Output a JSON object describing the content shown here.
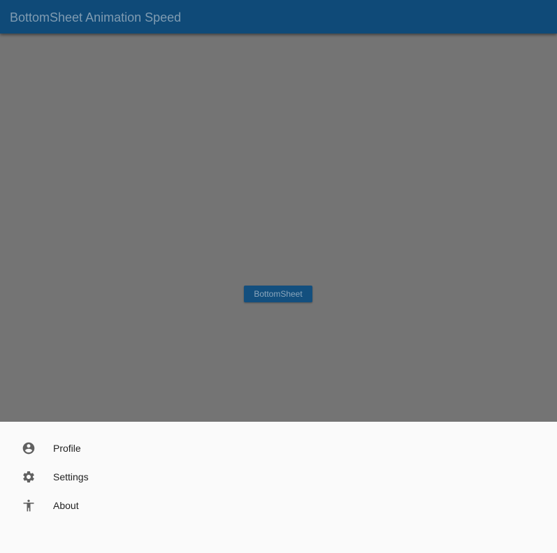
{
  "appbar": {
    "title": "BottomSheet Animation Speed",
    "background": "#0f4a78"
  },
  "main": {
    "button_label": "BottomSheet"
  },
  "bottom_sheet": {
    "items": [
      {
        "label": "Profile",
        "icon": "account-circle-icon"
      },
      {
        "label": "Settings",
        "icon": "gear-icon"
      },
      {
        "label": "About",
        "icon": "accessibility-icon"
      }
    ]
  },
  "colors": {
    "scrim": "#747474",
    "sheet_background": "#fafafa",
    "icon": "#616161"
  }
}
